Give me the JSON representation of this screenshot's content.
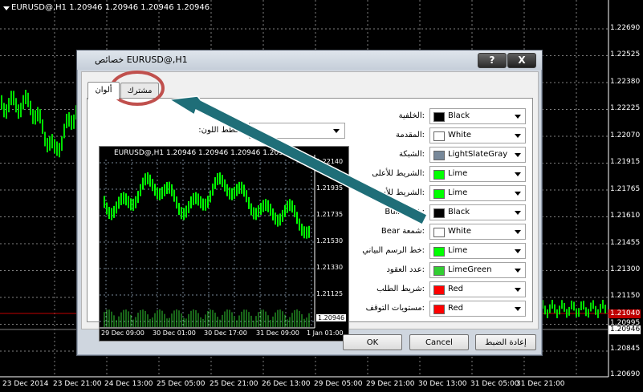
{
  "background_chart": {
    "title": "EURUSD@,H1  1.20946 1.20946 1.20946 1.20946",
    "price_labels": [
      "1.22690",
      "1.22525",
      "1.22380",
      "1.22225",
      "1.22070",
      "1.21915",
      "1.21765",
      "1.21610",
      "1.21455",
      "1.21300",
      "1.21150",
      "1.20995",
      "1.20946",
      "1.20845",
      "1.20690"
    ],
    "current_price_red": "1.21040",
    "current_price_white": "1.20946",
    "time_labels": [
      "23 Dec 2014",
      "23 Dec 21:00",
      "24 Dec 13:00",
      "25 Dec 05:00",
      "25 Dec 21:00",
      "26 Dec 13:00",
      "29 Dec 05:00",
      "29 Dec 21:00",
      "30 Dec 13:00",
      "31 Dec 05:00",
      "31 Dec 21:00"
    ],
    "colors": {
      "bars": "#00e000",
      "grid": "#808080",
      "red_line": "#c00000"
    }
  },
  "dialog": {
    "title": "خصائص EURUSD@,H1",
    "help_button": "?",
    "close_button": "X",
    "tabs": [
      {
        "label": "ألوان",
        "active": true
      },
      {
        "label": "مشترك",
        "active": false
      }
    ],
    "color_scheme_label": "مخطط اللون:",
    "color_scheme_value": "",
    "preview": {
      "title": "EURUSD@,H1  1.20946 1.20946 1.20946 1.20946",
      "price_labels": [
        "1.22140",
        "1.21935",
        "1.21735",
        "1.21530",
        "1.21330",
        "1.21125",
        "1.20946"
      ],
      "time_labels": [
        "29 Dec 09:00",
        "30 Dec 01:00",
        "30 Dec 17:00",
        "31 Dec 09:00",
        "1 Jan 01:00"
      ]
    },
    "color_rows": [
      {
        "label": ":الخلفية",
        "color_name": "Black",
        "hex": "#000000"
      },
      {
        "label": ":المقدمة",
        "color_name": "White",
        "hex": "#ffffff"
      },
      {
        "label": ":الشبكة",
        "color_name": "LightSlateGray",
        "hex": "#778899"
      },
      {
        "label": ":الشريط للأعلى",
        "color_name": "Lime",
        "hex": "#00ff00"
      },
      {
        "label": ":الشريط للأسفل",
        "color_name": "Lime",
        "hex": "#00ff00"
      },
      {
        "label": ":شمعة Bull",
        "color_name": "Black",
        "hex": "#000000"
      },
      {
        "label": ":شمعة Bear",
        "color_name": "White",
        "hex": "#ffffff"
      },
      {
        "label": ":خط الرسم البياني",
        "color_name": "Lime",
        "hex": "#00ff00"
      },
      {
        "label": ":عدد العقود",
        "color_name": "LimeGreen",
        "hex": "#32cd32"
      },
      {
        "label": ":شريط الطلب",
        "color_name": "Red",
        "hex": "#ff0000"
      },
      {
        "label": ":مستويات التوقف",
        "color_name": "Red",
        "hex": "#ff0000"
      }
    ],
    "buttons": {
      "ok": "OK",
      "cancel": "Cancel",
      "reset": "إعادة الضبط"
    }
  },
  "annotation": {
    "arrow_color": "#1f6e78",
    "circle_color": "#c0504d"
  }
}
